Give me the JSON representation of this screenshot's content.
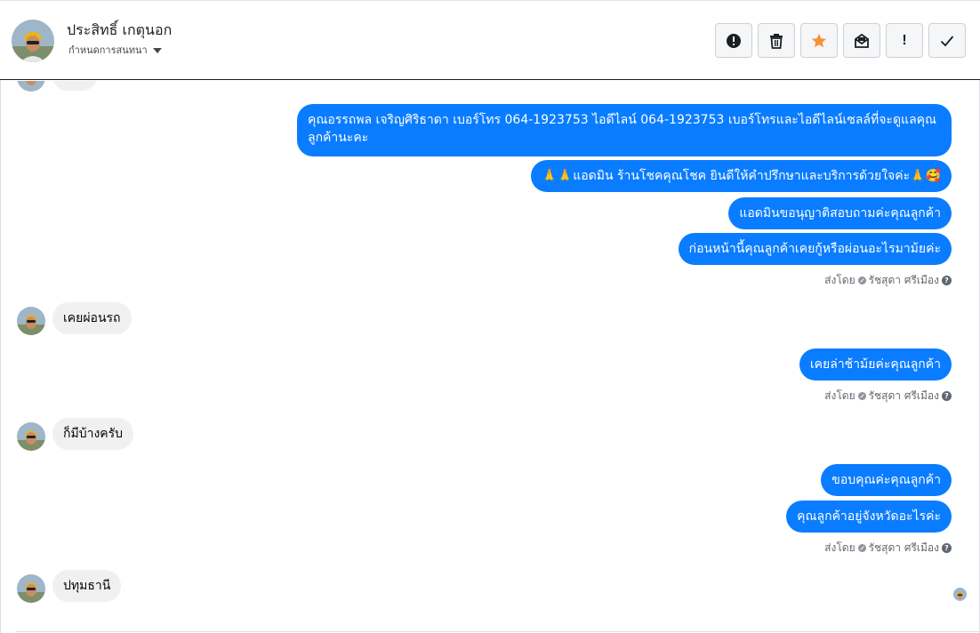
{
  "header": {
    "name": "ประสิทธิ์ เกตุนอก",
    "assign_label": "กำหนดการสนทนา",
    "avatar_icon": "user-avatar"
  },
  "toolbar": {
    "buttons": [
      {
        "name": "spam-button",
        "icon": "alert-circle-icon"
      },
      {
        "name": "delete-button",
        "icon": "trash-icon"
      },
      {
        "name": "star-button",
        "icon": "star-icon",
        "color": "#f7923b"
      },
      {
        "name": "mark-unread-button",
        "icon": "envelope-open-icon"
      },
      {
        "name": "follow-up-button",
        "icon": "exclamation-icon",
        "glyph": "!"
      },
      {
        "name": "done-button",
        "icon": "check-icon"
      }
    ]
  },
  "messages": {
    "out1": "คุณอรรถพล เจริญศิริธาดา      เบอร์โทร 064-1923753 ไอดีไลน์ 064-1923753   เบอร์โทรและไอดีไลน์เซลล์ที่จะดูแลคุณลูกค้านะคะ",
    "out2": "🙏🙏แอดมิน ร้านโชคคุณโชค ยินดีให้คำปรึกษาและบริการด้วยใจค่ะ🙏🥰",
    "out3": "แอดมินขอนุญาติสอบถามค่ะคุณลูกค้า",
    "out4": "ก่อนหน้านี้คุณลูกค้าเคยกู้หรือผ่อนอะไรมาม้ยค่ะ",
    "in1": "เคยผ่อนรถ",
    "out5": "เคยล่าช้าม้ยค่ะคุณลูกค้า",
    "in2": "ก็มีบ้างครับ",
    "out6": "ขอบคุณค่ะคุณลูกค้า",
    "out7": "คุณลูกค้าอยู่จังหวัดอะไรค่ะ",
    "in3": "ปทุมธานี"
  },
  "sent_by": {
    "prefix": "ส่งโดย",
    "agent": "รัชสุดา ศรีเมือง"
  },
  "colors": {
    "outgoing_bubble": "#0a7cff",
    "incoming_bubble": "#f0f0f0",
    "star": "#f7923b"
  }
}
